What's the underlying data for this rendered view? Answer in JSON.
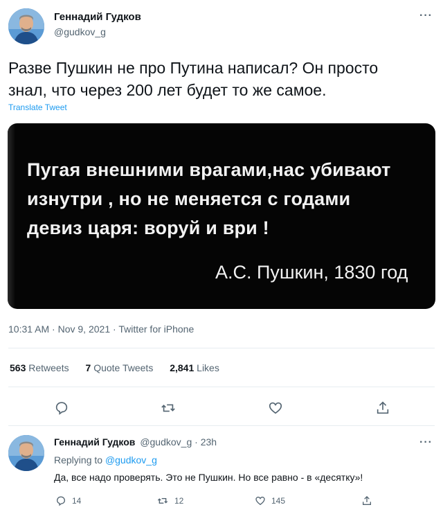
{
  "tweet": {
    "author_name": "Геннадий Гудков",
    "author_handle": "@gudkov_g",
    "more": "···",
    "text_line1": "Разве Пушкин не про Путина написал? Он просто",
    "text_line2": "знал, что через 200 лет будет то же самое.",
    "translate": "Translate Tweet",
    "image": {
      "line1": "Пугая внешними врагами,нас убивают",
      "line2": "изнутри , но не меняется с годами",
      "line3": "девиз царя: воруй и ври !",
      "attribution": "А.С. Пушкин, 1830 год"
    },
    "time": "10:31 AM",
    "date": "Nov 9, 2021",
    "source": "Twitter for iPhone",
    "stats": {
      "retweets_count": "563",
      "retweets_label": "Retweets",
      "quotes_count": "7",
      "quotes_label": "Quote Tweets",
      "likes_count": "2,841",
      "likes_label": "Likes"
    }
  },
  "reply": {
    "author_name": "Геннадий Гудков",
    "author_handle": "@gudkov_g",
    "time_ago": "23h",
    "more": "···",
    "replying_to_label": "Replying to",
    "replying_to_handle": "@gudkov_g",
    "text": "Да, все надо проверять. Это не Пушкин. Но все равно - в «десятку»!",
    "replies": "14",
    "retweets": "12",
    "likes": "145"
  },
  "icons": [
    "reply-icon",
    "retweet-icon",
    "like-icon",
    "share-icon",
    "more-icon"
  ],
  "colors": {
    "link": "#1d9bf0",
    "muted": "#536471",
    "text": "#0f1419"
  }
}
